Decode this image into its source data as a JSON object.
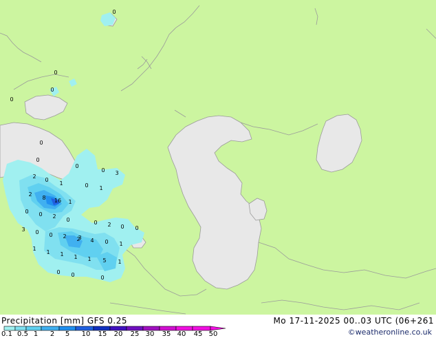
{
  "header": {
    "title": "Precipitation [mm]  GFS 0.25",
    "datetime": "Mo 17-11-2025 00..03 UTC (06+261",
    "credit": "©weatheronline.co.uk"
  },
  "legend": {
    "labels": [
      "0.1",
      "0.5",
      "1",
      "2",
      "5",
      "10",
      "15",
      "20",
      "25",
      "30",
      "35",
      "40",
      "45",
      "50"
    ],
    "colors": [
      "#a0f0f0",
      "#80e0f0",
      "#60d0f0",
      "#40b0f0",
      "#2090f0",
      "#2060e0",
      "#1030c0",
      "#4010c0",
      "#7010c0",
      "#a010c0",
      "#d010d0",
      "#f010e0"
    ]
  },
  "map": {
    "land_color": "#ccf5a0",
    "water_color": "#e8e8e8",
    "border_color": "#9a9a9a",
    "values": [
      {
        "text": "0"
      },
      {
        "text": "0"
      },
      {
        "text": "0"
      },
      {
        "text": "0"
      },
      {
        "text": "0"
      },
      {
        "text": "0"
      },
      {
        "text": "0"
      },
      {
        "text": "0"
      },
      {
        "text": "2"
      },
      {
        "text": "0"
      },
      {
        "text": "1"
      },
      {
        "text": "0"
      },
      {
        "text": "1"
      },
      {
        "text": "3"
      },
      {
        "text": "2"
      },
      {
        "text": "8"
      },
      {
        "text": "16"
      },
      {
        "text": "1"
      },
      {
        "text": "0"
      },
      {
        "text": "0"
      },
      {
        "text": "2"
      },
      {
        "text": "0"
      },
      {
        "text": "0"
      },
      {
        "text": "2"
      },
      {
        "text": "0"
      },
      {
        "text": "3"
      },
      {
        "text": "0"
      },
      {
        "text": "0"
      },
      {
        "text": "2"
      },
      {
        "text": "2"
      },
      {
        "text": "3"
      },
      {
        "text": "4"
      },
      {
        "text": "0"
      },
      {
        "text": "1"
      },
      {
        "text": "0"
      },
      {
        "text": "1"
      },
      {
        "text": "1"
      },
      {
        "text": "1"
      },
      {
        "text": "1"
      },
      {
        "text": "5"
      },
      {
        "text": "1"
      },
      {
        "text": "0"
      },
      {
        "text": "0"
      },
      {
        "text": "1"
      },
      {
        "text": "0"
      }
    ]
  }
}
